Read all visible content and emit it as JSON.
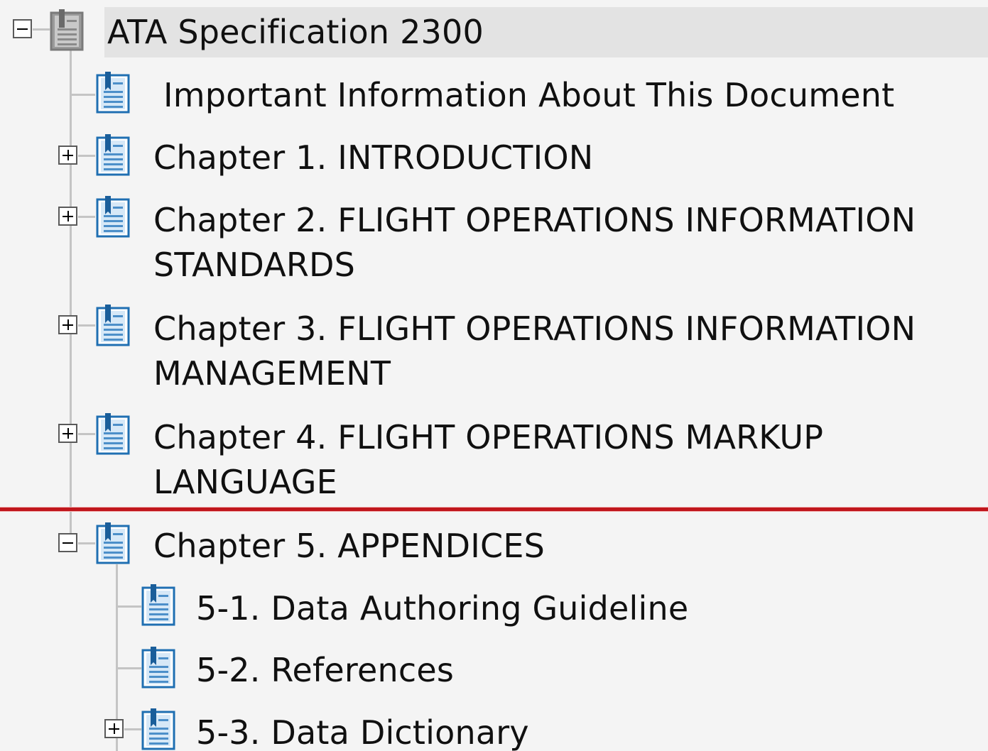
{
  "tree": {
    "root": {
      "label": "ATA Specification 2300",
      "expanded": true,
      "selected": true,
      "icon": "book-gray-icon"
    },
    "items": [
      {
        "id": "important-info",
        "label": "Important Information About This Document",
        "icon": "document-blue-icon",
        "has_children": false
      },
      {
        "id": "chapter-1",
        "label": "Chapter 1. INTRODUCTION",
        "icon": "document-blue-icon",
        "has_children": true,
        "expanded": false
      },
      {
        "id": "chapter-2",
        "label_line1": "Chapter 2.   FLIGHT OPERATIONS INFORMATION",
        "label_line2": "STANDARDS",
        "icon": "document-blue-icon",
        "has_children": true,
        "expanded": false
      },
      {
        "id": "chapter-3",
        "label_line1": "Chapter 3.   FLIGHT OPERATIONS INFORMATION",
        "label_line2": "MANAGEMENT",
        "icon": "document-blue-icon",
        "has_children": true,
        "expanded": false
      },
      {
        "id": "chapter-4",
        "label_line1": "Chapter 4.   FLIGHT OPERATIONS MARKUP",
        "label_line2": "LANGUAGE",
        "icon": "document-blue-icon",
        "has_children": true,
        "expanded": false
      },
      {
        "id": "chapter-5",
        "label": "Chapter 5.   APPENDICES",
        "icon": "document-blue-icon",
        "has_children": true,
        "expanded": true,
        "children": [
          {
            "id": "5-1",
            "label": "5-1. Data Authoring Guideline",
            "icon": "document-blue-icon",
            "has_children": false
          },
          {
            "id": "5-2",
            "label": "5-2.   References",
            "icon": "document-blue-icon",
            "has_children": false
          },
          {
            "id": "5-3",
            "label": "5-3.   Data Dictionary",
            "icon": "document-blue-icon",
            "has_children": true,
            "expanded": false
          }
        ]
      }
    ]
  },
  "colors": {
    "background": "#f4f4f4",
    "selection": "#e3e3e3",
    "tree_line": "#c4c4c4",
    "drop_indicator": "#c0161c",
    "icon_blue": "#1f6fb2",
    "icon_gray": "#8a8a8a"
  }
}
